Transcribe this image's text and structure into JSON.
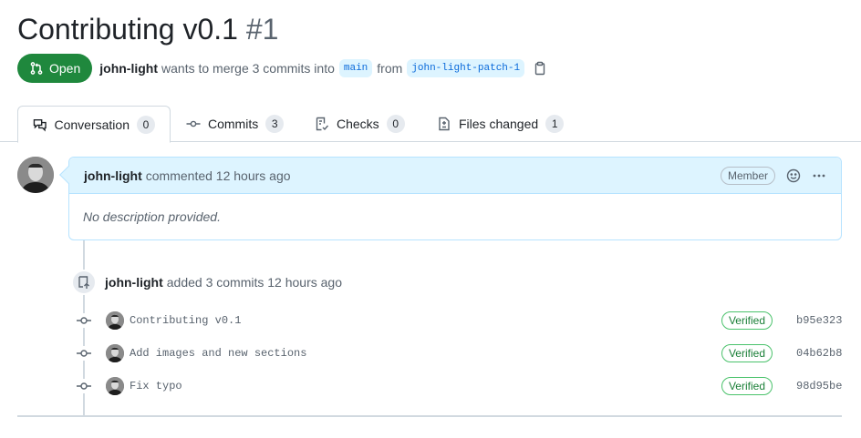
{
  "pr": {
    "title": "Contributing v0.1",
    "number": "#1",
    "state": "Open",
    "author": "john-light",
    "merge_text_1": "wants to merge 3 commits into",
    "base_branch": "main",
    "from_text": "from",
    "head_branch": "john-light-patch-1"
  },
  "tabs": [
    {
      "label": "Conversation",
      "count": "0",
      "icon": "comment-discussion-icon"
    },
    {
      "label": "Commits",
      "count": "3",
      "icon": "git-commit-icon"
    },
    {
      "label": "Checks",
      "count": "0",
      "icon": "checklist-icon"
    },
    {
      "label": "Files changed",
      "count": "1",
      "icon": "file-diff-icon"
    }
  ],
  "comment": {
    "author": "john-light",
    "action": "commented 12 hours ago",
    "role": "Member",
    "body": "No description provided."
  },
  "event": {
    "author": "john-light",
    "text": "added 3 commits 12 hours ago"
  },
  "commits": [
    {
      "message": "Contributing v0.1",
      "status": "Verified",
      "sha": "b95e323"
    },
    {
      "message": "Add images and new sections",
      "status": "Verified",
      "sha": "04b62b8"
    },
    {
      "message": "Fix typo",
      "status": "Verified",
      "sha": "98d95be"
    }
  ],
  "colors": {
    "open_state": "#1f883d",
    "branch_bg": "#ddf4ff",
    "branch_fg": "#0969da",
    "comment_header": "#ddf4ff",
    "verified": "#1a7f37"
  }
}
